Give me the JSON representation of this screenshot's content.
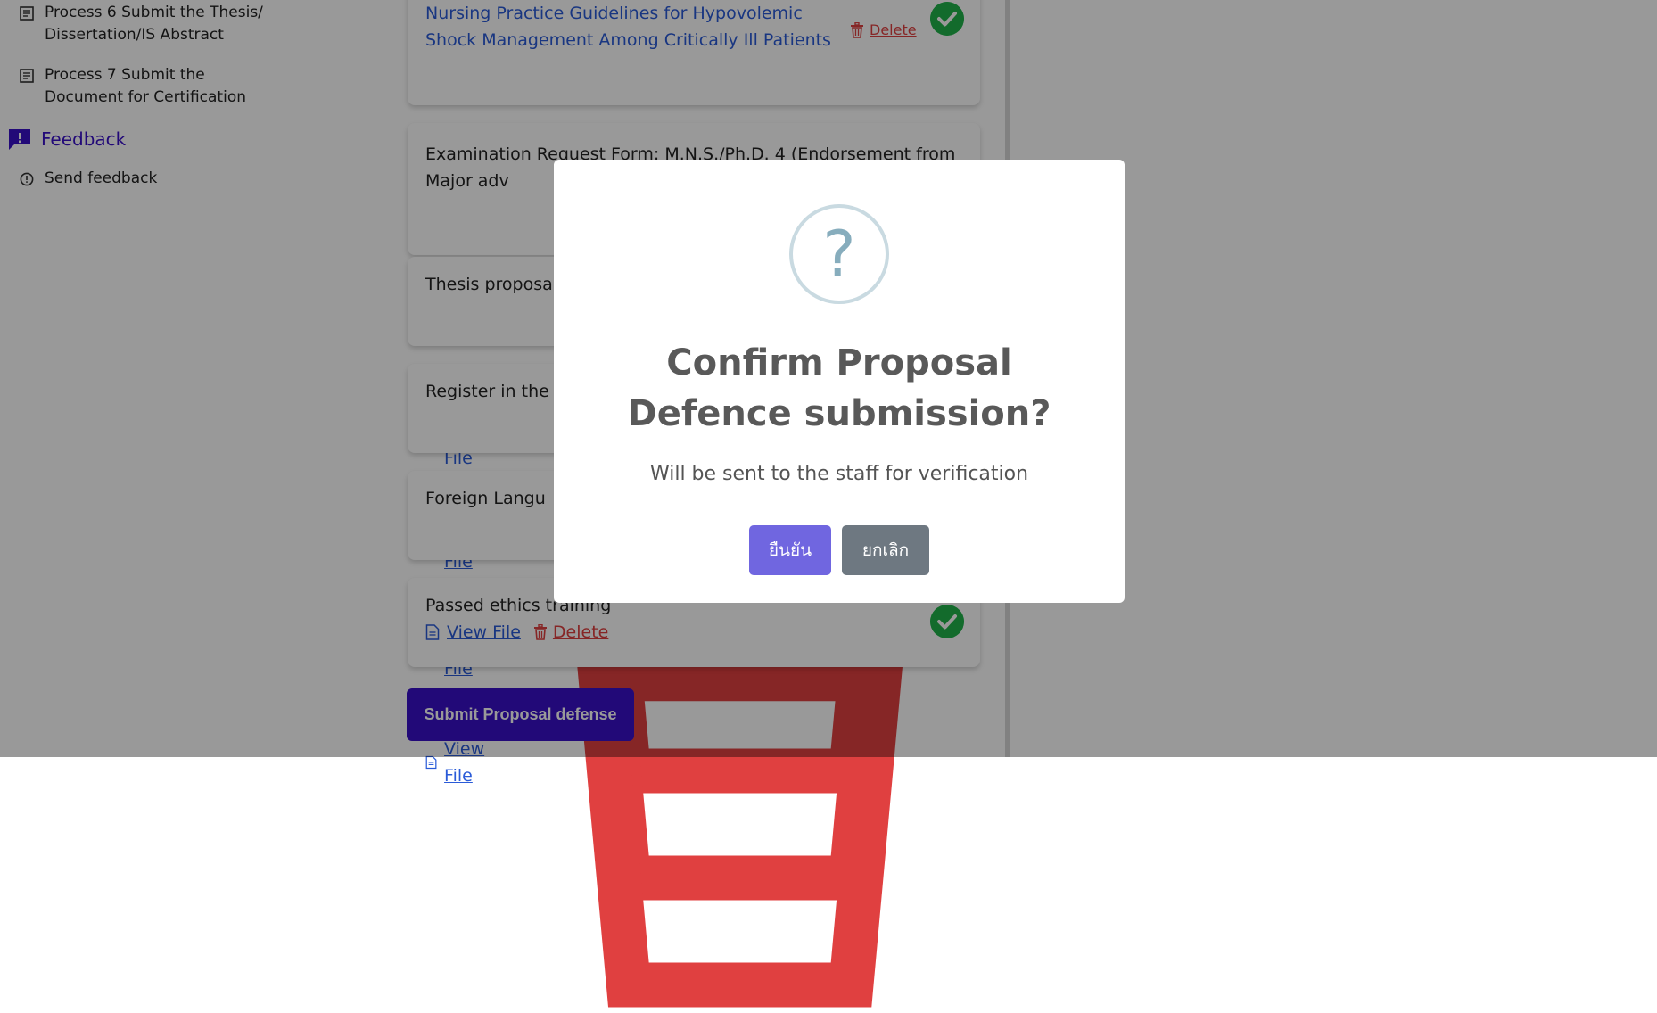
{
  "sidebar": {
    "items": [
      {
        "label": "Process 6 Submit the Thesis/ Dissertation/IS Abstract"
      },
      {
        "label": "Process 7 Submit the Document for Certification"
      }
    ],
    "feedback_heading": "Feedback",
    "send_feedback": "Send feedback"
  },
  "cards": [
    {
      "title": "Nursing Practice Guidelines for Hypovolemic Shock Management Among Critically Ill Patients",
      "delete_label": "Delete",
      "verified": true
    },
    {
      "title": "Examination Request Form: M.N.S./Ph.D. 4 (Endorsement from Major adv",
      "view_label": "View File"
    },
    {
      "title": "Thesis proposa",
      "view_label": "View File"
    },
    {
      "title": "Register in the",
      "view_label": "View File"
    },
    {
      "title": "Foreign Langu",
      "view_label": "View File"
    },
    {
      "title": "Passed ethics training",
      "view_label": "View File",
      "delete_label": "Delete",
      "verified": true
    }
  ],
  "submit_button": "Submit Proposal defense",
  "modal": {
    "icon": "?",
    "title": "Confirm Proposal Defence submission?",
    "text": "Will be sent to the staff for verification",
    "confirm": "ยืนยัน",
    "cancel": "ยกเลิก"
  },
  "colors": {
    "primary": "#3a10c8",
    "confirm": "#7066e0",
    "cancel": "#6e7881",
    "link": "#2a5bd8",
    "danger": "#e04040",
    "success": "#20b34a"
  }
}
